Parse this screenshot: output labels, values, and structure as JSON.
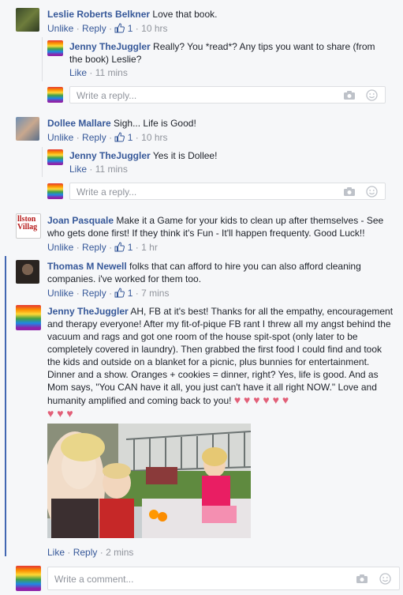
{
  "comments": [
    {
      "name": "Leslie Roberts Belkner",
      "text": "Love that book.",
      "actions": {
        "unlike": "Unlike",
        "reply": "Reply",
        "likes": "1",
        "time": "10 hrs"
      }
    },
    {
      "name": "Dollee Mallare",
      "text": "Sigh... Life is Good!",
      "actions": {
        "unlike": "Unlike",
        "reply": "Reply",
        "likes": "1",
        "time": "10 hrs"
      }
    },
    {
      "name": "Joan Pasquale",
      "text": "Make it a Game for your kids to clean up after themselves - See who gets done first! If they think it's Fun - It'll happen frequenty. Good Luck!!",
      "actions": {
        "unlike": "Unlike",
        "reply": "Reply",
        "likes": "1",
        "time": "1 hr"
      }
    },
    {
      "name": "Thomas M Newell",
      "text": "folks that can afford to hire you can also afford cleaning companies. i've worked for them too.",
      "actions": {
        "unlike": "Unlike",
        "reply": "Reply",
        "likes": "1",
        "time": "7 mins"
      }
    },
    {
      "name": "Jenny TheJuggler",
      "text": "AH, FB at it's best! Thanks for all the empathy, encouragement and therapy everyone! After my fit-of-pique FB rant I threw all my angst behind the vacuum and rags and got one room of the house spit-spot (only later to be completely covered in laundry). Then grabbed the first food I could find and took the kids and outside on a blanket for a picnic, plus bunnies for entertainment. Dinner and a show. Oranges + cookies = dinner, right? Yes, life is good. And as Mom says, \"You CAN have it all, you just can't have it all right NOW.\" Love and humanity amplified and coming back to you!",
      "actions": {
        "like": "Like",
        "reply": "Reply",
        "time": "2 mins"
      }
    }
  ],
  "replies": [
    {
      "name": "Jenny TheJuggler",
      "text": "Really? You *read*? Any tips you want to share (from the book) Leslie?",
      "actions": {
        "like": "Like",
        "time": "11 mins"
      }
    },
    {
      "name": "Jenny TheJuggler",
      "text": "Yes it is Dollee!",
      "actions": {
        "like": "Like",
        "time": "11 mins"
      }
    }
  ],
  "reply_placeholder": "Write a reply...",
  "comment_placeholder": "Write a comment...",
  "separator": "·",
  "colors": {
    "name": "#365899",
    "meta": "#90949c",
    "heart": "#e25f78"
  },
  "icons": [
    "camera-icon",
    "emoji-icon",
    "like-thumb-icon",
    "heart-icon"
  ]
}
